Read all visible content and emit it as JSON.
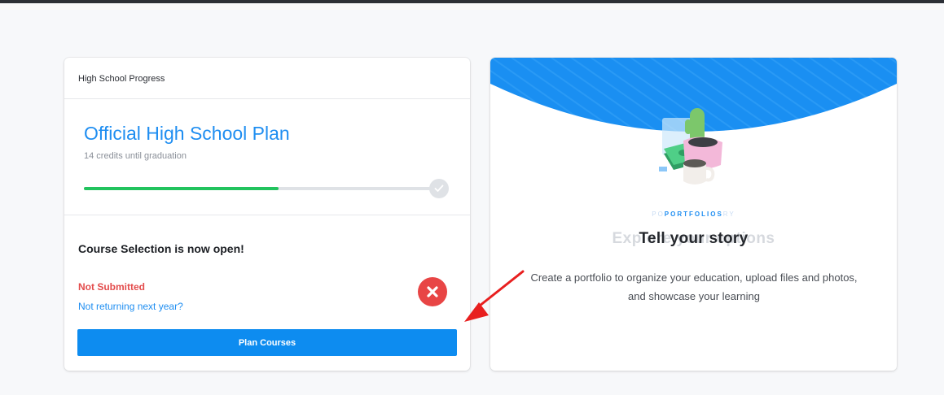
{
  "progress_card": {
    "header": "High School Progress",
    "plan_title": "Official High School Plan",
    "credits_text": "14 credits until graduation",
    "progress_fraction": 0.56,
    "progress_color": "#22c35e"
  },
  "course_selection": {
    "title": "Course Selection is now open!",
    "status": "Not Submitted",
    "status_color": "#e34c4c",
    "link": "Not returning next year?",
    "button": "Plan Courses",
    "button_color": "#0d8cf0"
  },
  "portfolio_card": {
    "kicker": "PORTFOLIOS",
    "kicker_ghost_left": "PO",
    "kicker_ghost_right": "RY",
    "ghost_title": "Explore your options",
    "title": "Tell your story",
    "description": "Create a portfolio to organize your education, upload files and photos, and showcase your learning",
    "banner_color": "#1a8ff2"
  },
  "annotation": {
    "arrow_color": "#e81f1f"
  }
}
